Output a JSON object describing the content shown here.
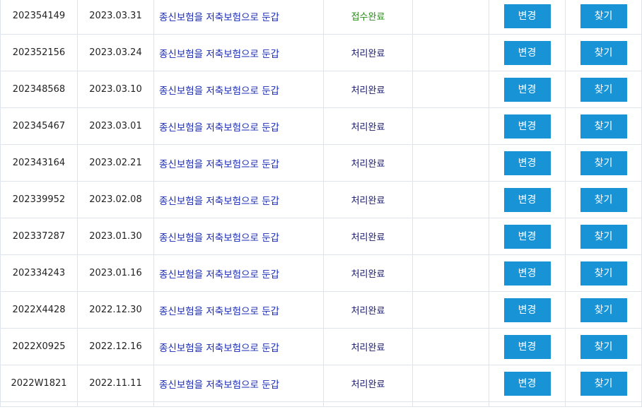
{
  "labels": {
    "change": "변경",
    "find": "찾기"
  },
  "colors": {
    "button_bg": "#1793d6",
    "title_text": "#1a2bb5",
    "status_received": "#2a8a1a",
    "status_done": "#1a1a66",
    "grid_border": "#dfe4ea"
  },
  "rows": [
    {
      "no": "202354149",
      "date": "2023.03.31",
      "title": "종신보험을 저축보험으로 둔갑",
      "status": "접수완료"
    },
    {
      "no": "202352156",
      "date": "2023.03.24",
      "title": "종신보험을 저축보험으로 둔갑",
      "status": "처리완료"
    },
    {
      "no": "202348568",
      "date": "2023.03.10",
      "title": "종신보험을 저축보험으로 둔갑",
      "status": "처리완료"
    },
    {
      "no": "202345467",
      "date": "2023.03.01",
      "title": "종신보험을 저축보험으로 둔갑",
      "status": "처리완료"
    },
    {
      "no": "202343164",
      "date": "2023.02.21",
      "title": "종신보험을 저축보험으로 둔갑",
      "status": "처리완료"
    },
    {
      "no": "202339952",
      "date": "2023.02.08",
      "title": "종신보험을 저축보험으로 둔갑",
      "status": "처리완료"
    },
    {
      "no": "202337287",
      "date": "2023.01.30",
      "title": "종신보험을 저축보험으로 둔갑",
      "status": "처리완료"
    },
    {
      "no": "202334243",
      "date": "2023.01.16",
      "title": "종신보험을 저축보험으로 둔갑",
      "status": "처리완료"
    },
    {
      "no": "2022X4428",
      "date": "2022.12.30",
      "title": "종신보험을 저축보험으로 둔갑",
      "status": "처리완료"
    },
    {
      "no": "2022X0925",
      "date": "2022.12.16",
      "title": "종신보험을 저축보험으로 둔갑",
      "status": "처리완료"
    },
    {
      "no": "2022W1821",
      "date": "2022.11.11",
      "title": "종신보험을 저축보험으로 둔갑",
      "status": "처리완료"
    }
  ]
}
